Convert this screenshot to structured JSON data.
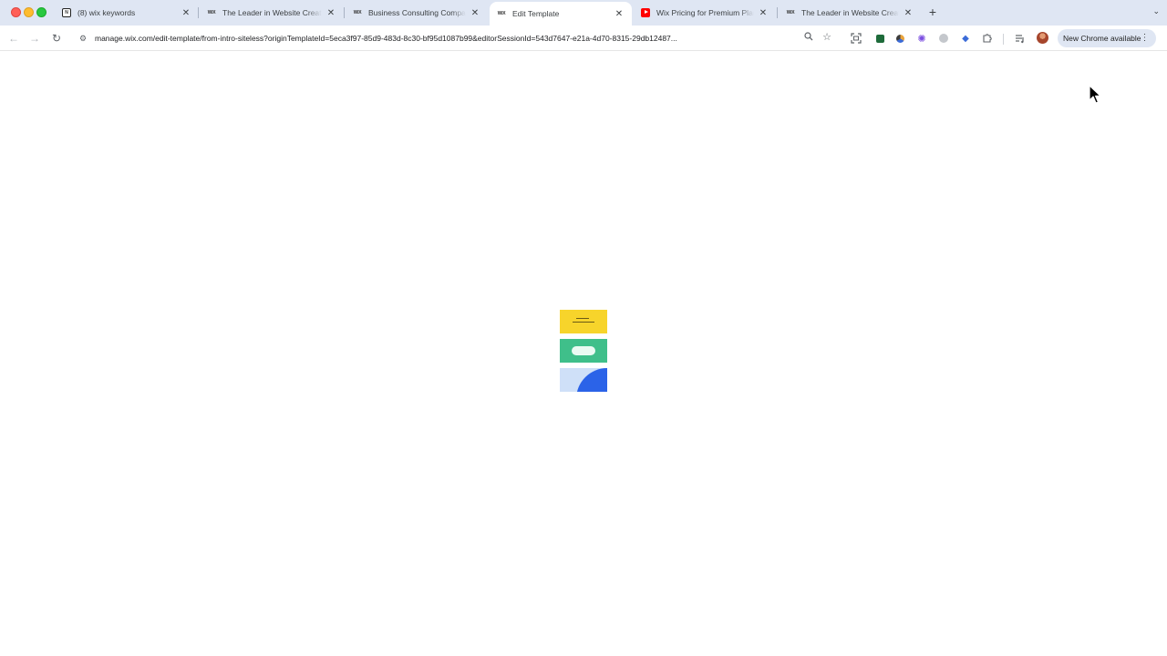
{
  "tabs": [
    {
      "title": "(8) wix keywords",
      "favicon": "notion-icon",
      "active": false
    },
    {
      "title": "The Leader in Website Creation",
      "favicon": "wix-icon",
      "active": false
    },
    {
      "title": "Business Consulting Company",
      "favicon": "wix-icon",
      "active": false
    },
    {
      "title": "Edit Template",
      "favicon": "wix-icon",
      "active": true
    },
    {
      "title": "Wix Pricing for Premium Plans",
      "favicon": "youtube-icon",
      "active": false
    },
    {
      "title": "The Leader in Website Creation",
      "favicon": "wix-icon",
      "active": false
    }
  ],
  "address_bar": {
    "url": "manage.wix.com/edit-template/from-intro-siteless?originTemplateId=5eca3f97-85d9-483d-8c30-bf95d1087b99&editorSessionId=543d7647-e21a-4d70-8315-29db12487..."
  },
  "toolbar": {
    "update_chip_label": "New Chrome available"
  },
  "loader": {
    "colors": {
      "yellow": "#f7d42b",
      "green": "#3fbf8a",
      "light_blue": "#cfe0f8",
      "blue": "#2b63e8"
    }
  },
  "favicon_text": {
    "notion": "N",
    "wix": "WiX"
  }
}
